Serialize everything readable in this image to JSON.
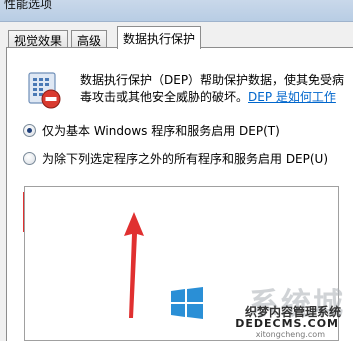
{
  "window": {
    "title": "性能选项"
  },
  "tabs": [
    {
      "label": "视觉效果"
    },
    {
      "label": "高级"
    },
    {
      "label": "数据执行保护"
    }
  ],
  "dep": {
    "description": "数据执行保护（DEP）帮助保护数据，使其免受病毒攻击或其他安全威胁的破坏。",
    "link": "DEP 是如何工作"
  },
  "options": [
    {
      "label": "仅为基本 Windows 程序和服务启用 DEP(T)",
      "checked": true
    },
    {
      "label": "为除下列选定程序之外的所有程序和服务启用 DEP(U)",
      "checked": false
    }
  ],
  "watermark": {
    "main": "系统城",
    "sub1": "织梦内容管理系统",
    "sub2": "DEDECMS.COM",
    "sub3": "xitongcheng.com"
  },
  "colors": {
    "highlight": "#e03030",
    "link": "#0066cc",
    "arrow": "#e03030"
  }
}
